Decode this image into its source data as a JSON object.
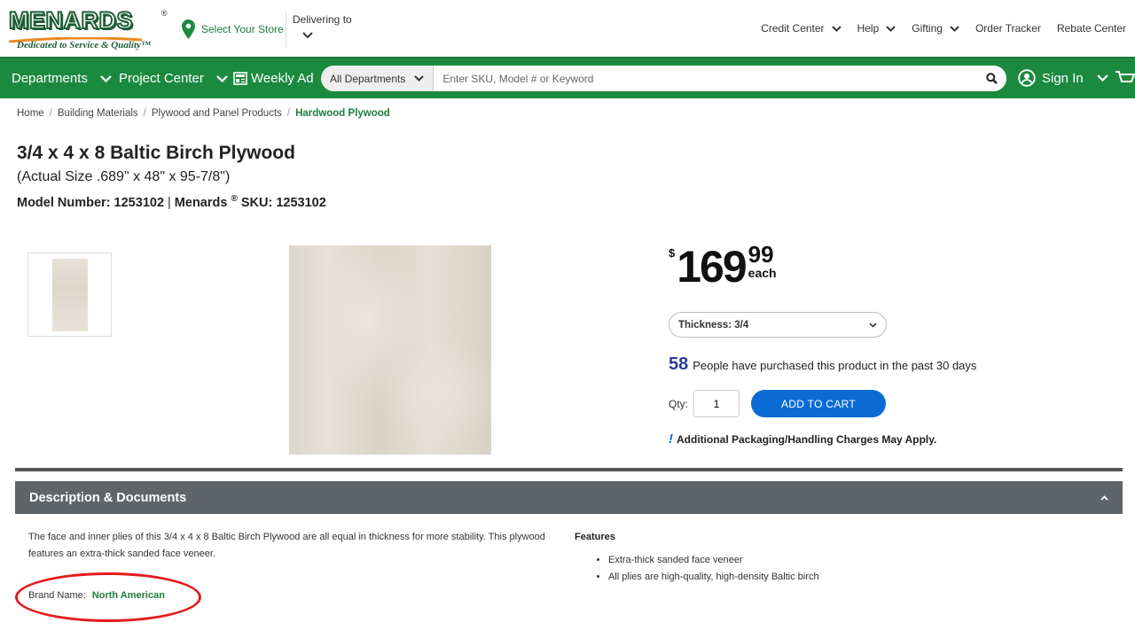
{
  "header": {
    "logo_text": "MENARDS",
    "logo_reg": "®",
    "logo_tagline": "Dedicated to Service & Quality™",
    "store_label": "Select Your Store",
    "delivering_label": "Delivering to",
    "top_links": [
      "Credit Center",
      "Help",
      "Gifting",
      "Order Tracker",
      "Rebate Center"
    ]
  },
  "nav": {
    "departments": "Departments",
    "project_center": "Project Center",
    "weekly_ad": "Weekly Ad",
    "search_dept": "All Departments",
    "search_placeholder": "Enter SKU, Model # or Keyword",
    "sign_in": "Sign In"
  },
  "breadcrumb": {
    "items": [
      "Home",
      "Building Materials",
      "Plywood and Panel Products"
    ],
    "current": "Hardwood Plywood",
    "sep": "/"
  },
  "product": {
    "title": "3/4 x 4 x 8 Baltic Birch Plywood",
    "actual_size": "(Actual Size .689\" x 48\" x 95-7/8\")",
    "model_line_a": "Model Number: 1253102",
    "model_line_b": "Menards",
    "model_line_reg": "®",
    "model_line_c": "SKU: 1253102",
    "price_currency": "$",
    "price_dollars": "169",
    "price_cents": "99",
    "price_unit": "each",
    "thickness_label": "Thickness: 3/4",
    "purchased_count": "58",
    "purchased_text": "People have purchased this product in the past 30 days",
    "qty_label": "Qty:",
    "qty_value": "1",
    "add_to_cart": "ADD TO CART",
    "handling_note": "Additional Packaging/Handling Charges May Apply."
  },
  "description": {
    "heading": "Description & Documents",
    "body": "The face and inner plies of this 3/4 x 4 x 8 Baltic Birch Plywood are all equal in thickness for more stability. This plywood features an extra-thick sanded face veneer.",
    "brand_label": "Brand Name:",
    "brand_value": "North American",
    "features_heading": "Features",
    "features": [
      "Extra-thick sanded face veneer",
      "All plies are high-quality, high-density Baltic birch"
    ]
  },
  "colors": {
    "brand_green": "#1b8a3f",
    "button_blue": "#0b6bd6",
    "annotation_red": "#e31b1b"
  }
}
